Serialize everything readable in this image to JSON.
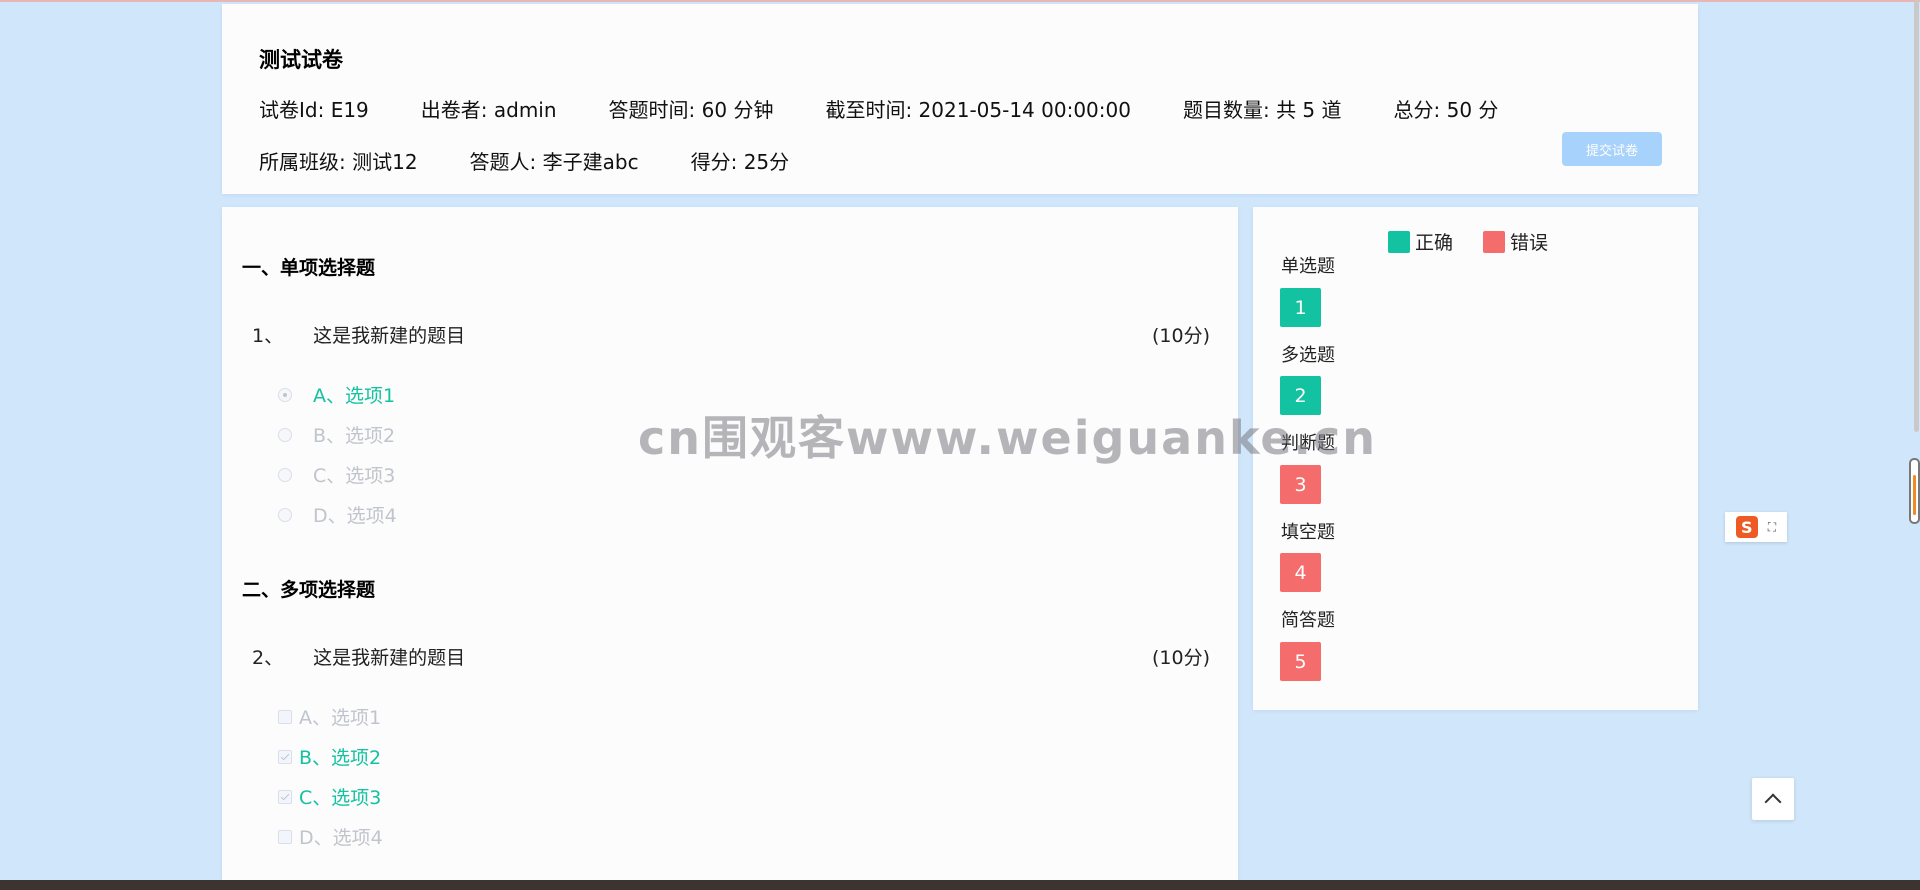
{
  "header": {
    "title": "测试试卷",
    "meta_row1": [
      "试卷Id: E19",
      "出卷者: admin",
      "答题时间: 60 分钟",
      "截至时间: 2021-05-14 00:00:00",
      "题目数量: 共 5 道",
      "总分: 50 分"
    ],
    "meta_row2": [
      "所属班级: 测试12",
      "答题人: 李子建abc",
      "得分: 25分"
    ],
    "submit_label": "提交试卷"
  },
  "questions": {
    "section1": {
      "title": "一、单项选择题",
      "question": {
        "num": "1、",
        "text": "这是我新建的题目",
        "score": "(10分)"
      },
      "options": [
        "A、选项1",
        "B、选项2",
        "C、选项3",
        "D、选项4"
      ],
      "selected": [
        0
      ]
    },
    "section2": {
      "title": "二、多项选择题",
      "question": {
        "num": "2、",
        "text": "这是我新建的题目",
        "score": "(10分)"
      },
      "options": [
        "A、选项1",
        "B、选项2",
        "C、选项3",
        "D、选项4"
      ],
      "selected": [
        1,
        2
      ]
    }
  },
  "answer_sheet": {
    "legend": {
      "correct": "正确",
      "wrong": "错误"
    },
    "colors": {
      "correct": "#13c2a0",
      "wrong": "#f56c6c"
    },
    "groups": [
      {
        "type": "单选题",
        "num": "1",
        "status": "correct"
      },
      {
        "type": "多选题",
        "num": "2",
        "status": "correct"
      },
      {
        "type": "判断题",
        "num": "3",
        "status": "wrong"
      },
      {
        "type": "填空题",
        "num": "4",
        "status": "wrong"
      },
      {
        "type": "简答题",
        "num": "5",
        "status": "wrong"
      }
    ]
  },
  "ime": {
    "logo": "S",
    "icon": "expand-icon"
  },
  "watermark": "cn围观客www.weiguanke.cn"
}
